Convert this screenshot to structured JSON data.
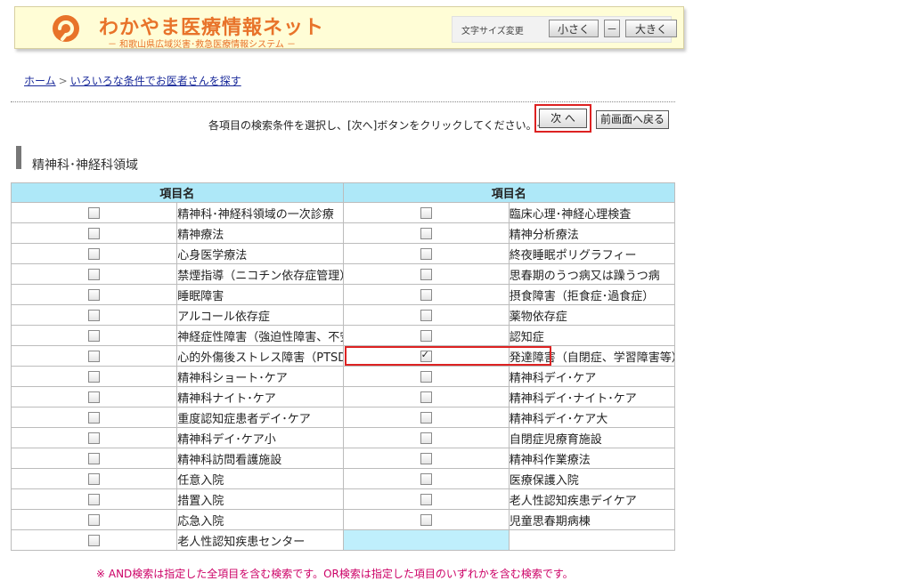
{
  "header": {
    "title": "わかやま医療情報ネット",
    "subtitle": "－ 和歌山県広域災害･救急医療情報システム －",
    "font_size_label": "文字サイズ変更",
    "small_label": "小さく",
    "mid_label": "－",
    "large_label": "大きく",
    "accent_color": "#e8732a"
  },
  "breadcrumb": {
    "home": "ホーム",
    "separator": ">",
    "current": "いろいろな条件でお医者さんを探す"
  },
  "instruction": "各項目の検索条件を選択し、[次へ]ボタンをクリックしてください。→",
  "buttons": {
    "next": "次 へ",
    "back": "前画面へ戻る"
  },
  "section_title": "精神科･神経科領域",
  "table": {
    "header_left": "項目名",
    "header_right": "項目名",
    "rows": [
      {
        "left": "精神科･神経科領域の一次診療",
        "left_checked": false,
        "right": "臨床心理･神経心理検査",
        "right_checked": false
      },
      {
        "left": "精神療法",
        "left_checked": false,
        "right": "精神分析療法",
        "right_checked": false
      },
      {
        "left": "心身医学療法",
        "left_checked": false,
        "right": "終夜睡眠ポリグラフィー",
        "right_checked": false
      },
      {
        "left": "禁煙指導（ニコチン依存症管理）",
        "left_checked": false,
        "right": "思春期のうつ病又は躁うつ病",
        "right_checked": false
      },
      {
        "left": "睡眠障害",
        "left_checked": false,
        "right": "摂食障害（拒食症･過食症）",
        "right_checked": false
      },
      {
        "left": "アルコール依存症",
        "left_checked": false,
        "right": "薬物依存症",
        "right_checked": false
      },
      {
        "left": "神経症性障害（強迫性障害、不安障害、パニック障害等）",
        "left_checked": false,
        "right": "認知症",
        "right_checked": false
      },
      {
        "left": "心的外傷後ストレス障害（PTSD）",
        "left_checked": false,
        "right": "発達障害（自閉症、学習障害等）",
        "right_checked": true
      },
      {
        "left": "精神科ショート･ケア",
        "left_checked": false,
        "right": "精神科デイ･ケア",
        "right_checked": false
      },
      {
        "left": "精神科ナイト･ケア",
        "left_checked": false,
        "right": "精神科デイ･ナイト･ケア",
        "right_checked": false
      },
      {
        "left": "重度認知症患者デイ･ケア",
        "left_checked": false,
        "right": "精神科デイ･ケア大",
        "right_checked": false
      },
      {
        "left": "精神科デイ･ケア小",
        "left_checked": false,
        "right": "自閉症児療育施設",
        "right_checked": false
      },
      {
        "left": "精神科訪問看護施設",
        "left_checked": false,
        "right": "精神科作業療法",
        "right_checked": false
      },
      {
        "left": "任意入院",
        "left_checked": false,
        "right": "医療保護入院",
        "right_checked": false
      },
      {
        "left": "措置入院",
        "left_checked": false,
        "right": "老人性認知疾患デイケア",
        "right_checked": false
      },
      {
        "left": "応急入院",
        "left_checked": false,
        "right": "児童思春期病棟",
        "right_checked": false
      },
      {
        "left": "老人性認知疾患センター",
        "left_checked": false,
        "right": "",
        "right_checked": false
      }
    ]
  },
  "footnote": "※ AND検索は指定した全項目を含む検索です。OR検索は指定した項目のいずれかを含む検索です。"
}
